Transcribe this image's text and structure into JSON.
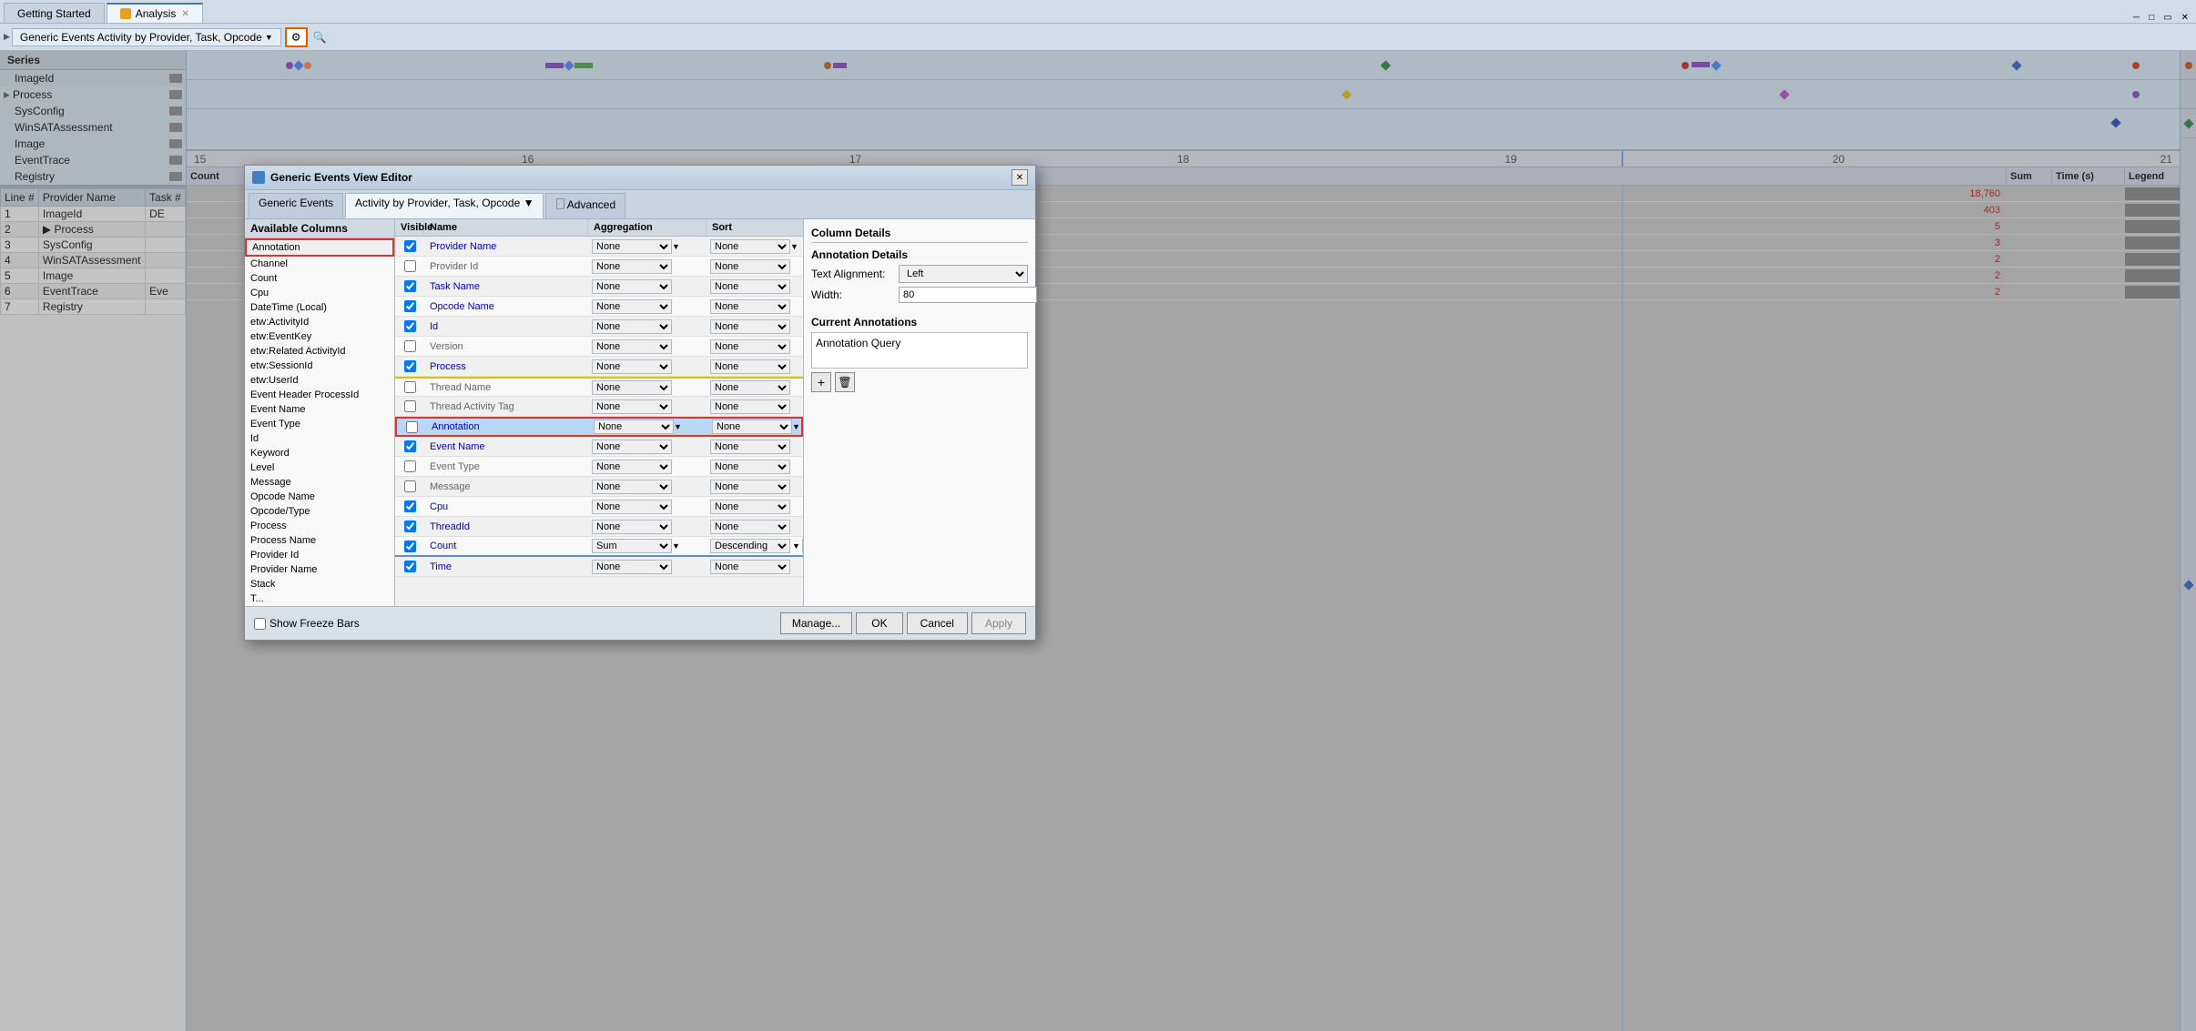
{
  "tabs": [
    {
      "label": "Getting Started",
      "active": false
    },
    {
      "label": "Analysis",
      "active": true,
      "icon": true
    }
  ],
  "toolbar": {
    "label": "Generic Events  Activity by Provider, Task, Opcode",
    "gear_label": "⚙",
    "search_label": "🔍"
  },
  "series": {
    "header": "Series",
    "items": [
      {
        "label": "ImageId",
        "has_arrow": false
      },
      {
        "label": "Process",
        "has_arrow": true
      },
      {
        "label": "SysConfig",
        "has_arrow": false
      },
      {
        "label": "WinSATAssessment",
        "has_arrow": false
      },
      {
        "label": "Image",
        "has_arrow": false
      },
      {
        "label": "EventTrace",
        "has_arrow": false
      },
      {
        "label": "Registry",
        "has_arrow": false
      }
    ]
  },
  "data_table": {
    "headers": [
      "Line #",
      "Provider Name",
      "Task #"
    ],
    "rows": [
      {
        "line": "1",
        "provider": "ImageId",
        "task": "DE"
      },
      {
        "line": "2",
        "provider": "Process",
        "task": ""
      },
      {
        "line": "3",
        "provider": "SysConfig",
        "task": ""
      },
      {
        "line": "4",
        "provider": "WinSATAssessment",
        "task": ""
      },
      {
        "line": "5",
        "provider": "Image",
        "task": ""
      },
      {
        "line": "6",
        "provider": "EventTrace",
        "task": "Eve"
      },
      {
        "line": "7",
        "provider": "Registry",
        "task": ""
      }
    ]
  },
  "timeline": {
    "col_headers": [
      "Count",
      "Sum",
      "Time (s)",
      "Legend"
    ],
    "ruler_labels": [
      "15",
      "16",
      "17",
      "18",
      "19",
      "20",
      "21"
    ],
    "rows": [
      {
        "count": "18,760",
        "color": "#cc2200"
      },
      {
        "count": "403",
        "color": "#cc2200"
      },
      {
        "count": "5",
        "color": "#cc2200"
      },
      {
        "count": "3",
        "color": "#cc2200"
      },
      {
        "count": "2",
        "color": "#cc2200"
      },
      {
        "count": "2",
        "color": "#cc2200"
      },
      {
        "count": "2",
        "color": "#cc2200"
      }
    ]
  },
  "modal": {
    "title": "Generic Events View Editor",
    "tabs": [
      "Generic Events",
      "Activity by Provider, Task, Opcode ▼",
      "🗌 Advanced"
    ],
    "available_columns_header": "Available Columns",
    "columns_headers": [
      "Visible",
      "Name",
      "Aggregation",
      "Sort"
    ],
    "column_details_header": "Column Details",
    "available_columns": [
      "Annotation",
      "Channel",
      "Count",
      "Cpu",
      "DateTime (Local)",
      "etw:ActivityId",
      "etw:EventKey",
      "etw:Related ActivityId",
      "etw:SessionId",
      "etw:UserId",
      "Event Header ProcessId",
      "Event Name",
      "Event Type",
      "Id",
      "Keyword",
      "Level",
      "Message",
      "Opcode Name",
      "Opcode/Type",
      "Process",
      "Process Name",
      "Provider Id",
      "Provider Name",
      "Stack",
      "T..."
    ],
    "columns": [
      {
        "visible": true,
        "name": "Provider Name",
        "agg": "None",
        "sort": "None",
        "blue": true
      },
      {
        "visible": false,
        "name": "Provider Id",
        "agg": "None",
        "sort": "None",
        "blue": false
      },
      {
        "visible": true,
        "name": "Task Name",
        "agg": "None",
        "sort": "None",
        "blue": true
      },
      {
        "visible": true,
        "name": "Opcode Name",
        "agg": "None",
        "sort": "None",
        "blue": true
      },
      {
        "visible": true,
        "name": "Id",
        "agg": "None",
        "sort": "None",
        "blue": true
      },
      {
        "visible": false,
        "name": "Version",
        "agg": "None",
        "sort": "None",
        "blue": false
      },
      {
        "visible": true,
        "name": "Process",
        "agg": "None",
        "sort": "None",
        "blue": true
      },
      {
        "visible": false,
        "name": "Thread Name",
        "agg": "None",
        "sort": "None",
        "blue": false,
        "yellow_border": true
      },
      {
        "visible": false,
        "name": "Thread Activity Tag",
        "agg": "None",
        "sort": "None",
        "blue": false
      },
      {
        "visible": false,
        "name": "Annotation",
        "agg": "None",
        "sort": "None",
        "blue": true,
        "highlighted": true
      },
      {
        "visible": true,
        "name": "Event Name",
        "agg": "None",
        "sort": "None",
        "blue": true
      },
      {
        "visible": false,
        "name": "Event Type",
        "agg": "None",
        "sort": "None",
        "blue": false
      },
      {
        "visible": false,
        "name": "Message",
        "agg": "None",
        "sort": "None",
        "blue": false
      },
      {
        "visible": true,
        "name": "Cpu",
        "agg": "None",
        "sort": "None",
        "blue": true
      },
      {
        "visible": true,
        "name": "ThreadId",
        "agg": "None",
        "sort": "None",
        "blue": true
      },
      {
        "visible": true,
        "name": "Count",
        "agg": "Sum",
        "sort": "Descending",
        "sort_num": "0",
        "blue": true,
        "count_row": true
      },
      {
        "visible": true,
        "name": "Time",
        "agg": "None",
        "sort": "None",
        "blue": true
      }
    ],
    "show_freeze_bars": false,
    "show_freeze_label": "Show Freeze Bars",
    "annotation_details": {
      "header": "Annotation Details",
      "text_alignment_label": "Text Alignment:",
      "text_alignment_value": "Left",
      "width_label": "Width:",
      "width_value": "80"
    },
    "current_annotations": {
      "header": "Current Annotations",
      "value": "Annotation Query"
    },
    "buttons": {
      "manage": "Manage...",
      "ok": "OK",
      "cancel": "Cancel",
      "apply": "Apply"
    }
  }
}
